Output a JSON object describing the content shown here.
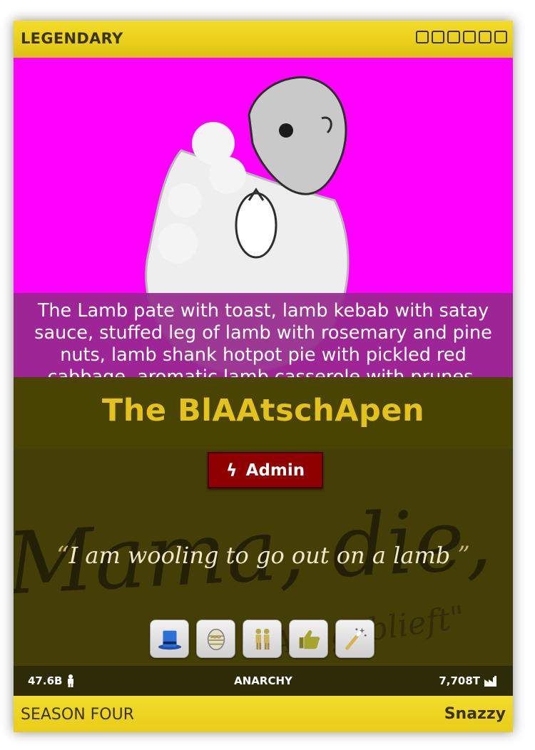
{
  "card": {
    "rarity": "LEGENDARY",
    "star_count": 6,
    "description": "The Lamb pate with toast, lamb kebab with satay sauce, stuffed leg of lamb with rosemary and pine nuts, lamb shank hotpot pie with pickled red cabbage, aromatic lamb casserole with prunes, fruity lamb tagine of",
    "name": "The BlAAtschApen",
    "role": {
      "label": "Admin",
      "icon": "lightning-icon",
      "color": "#8f0000"
    },
    "quote": {
      "open": "“",
      "text": "I am wooling to go out on a lamb",
      "close": "”"
    },
    "background_text": "Mama, die, die",
    "background_text_2": "Ausgeblieft\"",
    "badges": [
      "top-hat-icon",
      "easter-egg-icon",
      "couple-icon",
      "thumbs-up-icon",
      "magic-wand-icon"
    ],
    "stats": {
      "population": "47.6B",
      "government": "ANARCHY",
      "economy": "7,708T"
    },
    "season": "SEASON FOUR",
    "tier": "Snazzy",
    "colors": {
      "art_background": "#ff00ff",
      "title": "#e3c21b",
      "frame": "#f3dc2a",
      "description_overlay": "#96288c"
    }
  }
}
